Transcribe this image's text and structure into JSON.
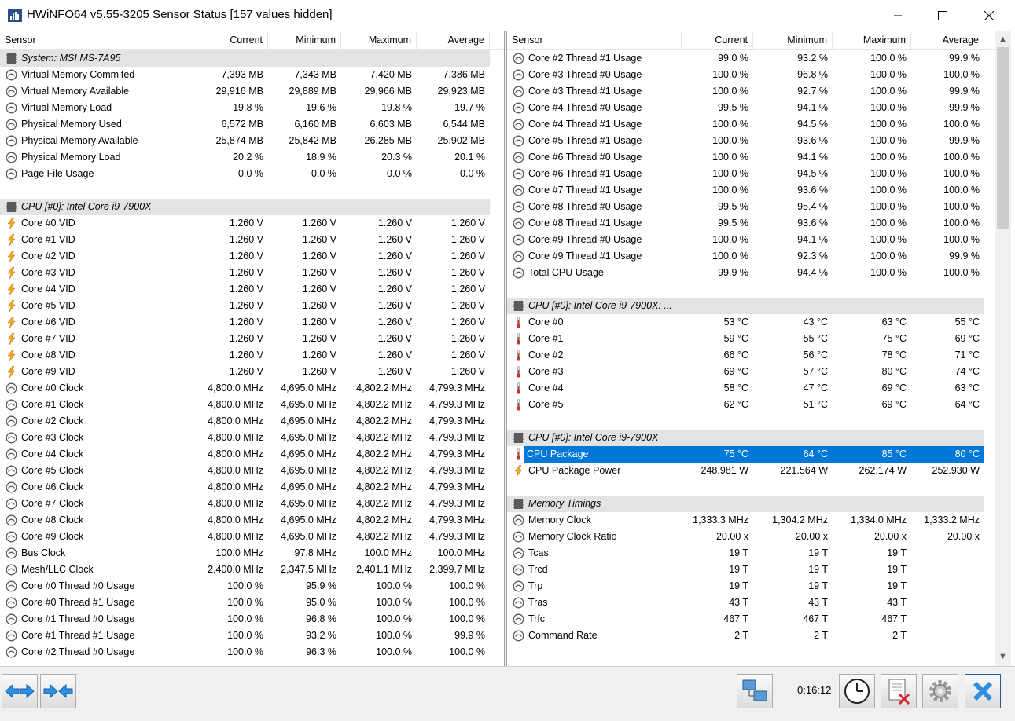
{
  "window": {
    "title": "HWiNFO64 v5.55-3205 Sensor Status [157 values hidden]"
  },
  "columns": {
    "sensor": "Sensor",
    "current": "Current",
    "minimum": "Minimum",
    "maximum": "Maximum",
    "average": "Average"
  },
  "left_rows": [
    {
      "t": "g",
      "icon": "chip",
      "name": "System: MSI MS-7A95"
    },
    {
      "t": "r",
      "icon": "gauge",
      "name": "Virtual Memory Commited",
      "v": [
        "7,393 MB",
        "7,343 MB",
        "7,420 MB",
        "7,386 MB"
      ]
    },
    {
      "t": "r",
      "icon": "gauge",
      "name": "Virtual Memory Available",
      "v": [
        "29,916 MB",
        "29,889 MB",
        "29,966 MB",
        "29,923 MB"
      ]
    },
    {
      "t": "r",
      "icon": "gauge",
      "name": "Virtual Memory Load",
      "v": [
        "19.8 %",
        "19.6 %",
        "19.8 %",
        "19.7 %"
      ]
    },
    {
      "t": "r",
      "icon": "gauge",
      "name": "Physical Memory Used",
      "v": [
        "6,572 MB",
        "6,160 MB",
        "6,603 MB",
        "6,544 MB"
      ]
    },
    {
      "t": "r",
      "icon": "gauge",
      "name": "Physical Memory Available",
      "v": [
        "25,874 MB",
        "25,842 MB",
        "26,285 MB",
        "25,902 MB"
      ]
    },
    {
      "t": "r",
      "icon": "gauge",
      "name": "Physical Memory Load",
      "v": [
        "20.2 %",
        "18.9 %",
        "20.3 %",
        "20.1 %"
      ]
    },
    {
      "t": "r",
      "icon": "gauge",
      "name": "Page File Usage",
      "v": [
        "0.0 %",
        "0.0 %",
        "0.0 %",
        "0.0 %"
      ]
    },
    {
      "t": "e"
    },
    {
      "t": "g",
      "icon": "chip",
      "name": "CPU [#0]: Intel Core i9-7900X"
    },
    {
      "t": "r",
      "icon": "bolt",
      "name": "Core #0 VID",
      "v": [
        "1.260 V",
        "1.260 V",
        "1.260 V",
        "1.260 V"
      ]
    },
    {
      "t": "r",
      "icon": "bolt",
      "name": "Core #1 VID",
      "v": [
        "1.260 V",
        "1.260 V",
        "1.260 V",
        "1.260 V"
      ]
    },
    {
      "t": "r",
      "icon": "bolt",
      "name": "Core #2 VID",
      "v": [
        "1.260 V",
        "1.260 V",
        "1.260 V",
        "1.260 V"
      ]
    },
    {
      "t": "r",
      "icon": "bolt",
      "name": "Core #3 VID",
      "v": [
        "1.260 V",
        "1.260 V",
        "1.260 V",
        "1.260 V"
      ]
    },
    {
      "t": "r",
      "icon": "bolt",
      "name": "Core #4 VID",
      "v": [
        "1.260 V",
        "1.260 V",
        "1.260 V",
        "1.260 V"
      ]
    },
    {
      "t": "r",
      "icon": "bolt",
      "name": "Core #5 VID",
      "v": [
        "1.260 V",
        "1.260 V",
        "1.260 V",
        "1.260 V"
      ]
    },
    {
      "t": "r",
      "icon": "bolt",
      "name": "Core #6 VID",
      "v": [
        "1.260 V",
        "1.260 V",
        "1.260 V",
        "1.260 V"
      ]
    },
    {
      "t": "r",
      "icon": "bolt",
      "name": "Core #7 VID",
      "v": [
        "1.260 V",
        "1.260 V",
        "1.260 V",
        "1.260 V"
      ]
    },
    {
      "t": "r",
      "icon": "bolt",
      "name": "Core #8 VID",
      "v": [
        "1.260 V",
        "1.260 V",
        "1.260 V",
        "1.260 V"
      ]
    },
    {
      "t": "r",
      "icon": "bolt",
      "name": "Core #9 VID",
      "v": [
        "1.260 V",
        "1.260 V",
        "1.260 V",
        "1.260 V"
      ]
    },
    {
      "t": "r",
      "icon": "gauge",
      "name": "Core #0 Clock",
      "v": [
        "4,800.0 MHz",
        "4,695.0 MHz",
        "4,802.2 MHz",
        "4,799.3 MHz"
      ]
    },
    {
      "t": "r",
      "icon": "gauge",
      "name": "Core #1 Clock",
      "v": [
        "4,800.0 MHz",
        "4,695.0 MHz",
        "4,802.2 MHz",
        "4,799.3 MHz"
      ]
    },
    {
      "t": "r",
      "icon": "gauge",
      "name": "Core #2 Clock",
      "v": [
        "4,800.0 MHz",
        "4,695.0 MHz",
        "4,802.2 MHz",
        "4,799.3 MHz"
      ]
    },
    {
      "t": "r",
      "icon": "gauge",
      "name": "Core #3 Clock",
      "v": [
        "4,800.0 MHz",
        "4,695.0 MHz",
        "4,802.2 MHz",
        "4,799.3 MHz"
      ]
    },
    {
      "t": "r",
      "icon": "gauge",
      "name": "Core #4 Clock",
      "v": [
        "4,800.0 MHz",
        "4,695.0 MHz",
        "4,802.2 MHz",
        "4,799.3 MHz"
      ]
    },
    {
      "t": "r",
      "icon": "gauge",
      "name": "Core #5 Clock",
      "v": [
        "4,800.0 MHz",
        "4,695.0 MHz",
        "4,802.2 MHz",
        "4,799.3 MHz"
      ]
    },
    {
      "t": "r",
      "icon": "gauge",
      "name": "Core #6 Clock",
      "v": [
        "4,800.0 MHz",
        "4,695.0 MHz",
        "4,802.2 MHz",
        "4,799.3 MHz"
      ]
    },
    {
      "t": "r",
      "icon": "gauge",
      "name": "Core #7 Clock",
      "v": [
        "4,800.0 MHz",
        "4,695.0 MHz",
        "4,802.2 MHz",
        "4,799.3 MHz"
      ]
    },
    {
      "t": "r",
      "icon": "gauge",
      "name": "Core #8 Clock",
      "v": [
        "4,800.0 MHz",
        "4,695.0 MHz",
        "4,802.2 MHz",
        "4,799.3 MHz"
      ]
    },
    {
      "t": "r",
      "icon": "gauge",
      "name": "Core #9 Clock",
      "v": [
        "4,800.0 MHz",
        "4,695.0 MHz",
        "4,802.2 MHz",
        "4,799.3 MHz"
      ]
    },
    {
      "t": "r",
      "icon": "gauge",
      "name": "Bus Clock",
      "v": [
        "100.0 MHz",
        "97.8 MHz",
        "100.0 MHz",
        "100.0 MHz"
      ]
    },
    {
      "t": "r",
      "icon": "gauge",
      "name": "Mesh/LLC Clock",
      "v": [
        "2,400.0 MHz",
        "2,347.5 MHz",
        "2,401.1 MHz",
        "2,399.7 MHz"
      ]
    },
    {
      "t": "r",
      "icon": "gauge",
      "name": "Core #0 Thread #0 Usage",
      "v": [
        "100.0 %",
        "95.9 %",
        "100.0 %",
        "100.0 %"
      ]
    },
    {
      "t": "r",
      "icon": "gauge",
      "name": "Core #0 Thread #1 Usage",
      "v": [
        "100.0 %",
        "95.0 %",
        "100.0 %",
        "100.0 %"
      ]
    },
    {
      "t": "r",
      "icon": "gauge",
      "name": "Core #1 Thread #0 Usage",
      "v": [
        "100.0 %",
        "96.8 %",
        "100.0 %",
        "100.0 %"
      ]
    },
    {
      "t": "r",
      "icon": "gauge",
      "name": "Core #1 Thread #1 Usage",
      "v": [
        "100.0 %",
        "93.2 %",
        "100.0 %",
        "99.9 %"
      ]
    },
    {
      "t": "r",
      "icon": "gauge",
      "name": "Core #2 Thread #0 Usage",
      "v": [
        "100.0 %",
        "96.3 %",
        "100.0 %",
        "100.0 %"
      ]
    }
  ],
  "right_rows": [
    {
      "t": "r",
      "icon": "gauge",
      "name": "Core #2 Thread #1 Usage",
      "v": [
        "99.0 %",
        "93.2 %",
        "100.0 %",
        "99.9 %"
      ]
    },
    {
      "t": "r",
      "icon": "gauge",
      "name": "Core #3 Thread #0 Usage",
      "v": [
        "100.0 %",
        "96.8 %",
        "100.0 %",
        "100.0 %"
      ]
    },
    {
      "t": "r",
      "icon": "gauge",
      "name": "Core #3 Thread #1 Usage",
      "v": [
        "100.0 %",
        "92.7 %",
        "100.0 %",
        "99.9 %"
      ]
    },
    {
      "t": "r",
      "icon": "gauge",
      "name": "Core #4 Thread #0 Usage",
      "v": [
        "99.5 %",
        "94.1 %",
        "100.0 %",
        "99.9 %"
      ]
    },
    {
      "t": "r",
      "icon": "gauge",
      "name": "Core #4 Thread #1 Usage",
      "v": [
        "100.0 %",
        "94.5 %",
        "100.0 %",
        "100.0 %"
      ]
    },
    {
      "t": "r",
      "icon": "gauge",
      "name": "Core #5 Thread #1 Usage",
      "v": [
        "100.0 %",
        "93.6 %",
        "100.0 %",
        "99.9 %"
      ]
    },
    {
      "t": "r",
      "icon": "gauge",
      "name": "Core #6 Thread #0 Usage",
      "v": [
        "100.0 %",
        "94.1 %",
        "100.0 %",
        "100.0 %"
      ]
    },
    {
      "t": "r",
      "icon": "gauge",
      "name": "Core #6 Thread #1 Usage",
      "v": [
        "100.0 %",
        "94.5 %",
        "100.0 %",
        "100.0 %"
      ]
    },
    {
      "t": "r",
      "icon": "gauge",
      "name": "Core #7 Thread #1 Usage",
      "v": [
        "100.0 %",
        "93.6 %",
        "100.0 %",
        "100.0 %"
      ]
    },
    {
      "t": "r",
      "icon": "gauge",
      "name": "Core #8 Thread #0 Usage",
      "v": [
        "99.5 %",
        "95.4 %",
        "100.0 %",
        "100.0 %"
      ]
    },
    {
      "t": "r",
      "icon": "gauge",
      "name": "Core #8 Thread #1 Usage",
      "v": [
        "99.5 %",
        "93.6 %",
        "100.0 %",
        "100.0 %"
      ]
    },
    {
      "t": "r",
      "icon": "gauge",
      "name": "Core #9 Thread #0 Usage",
      "v": [
        "100.0 %",
        "94.1 %",
        "100.0 %",
        "100.0 %"
      ]
    },
    {
      "t": "r",
      "icon": "gauge",
      "name": "Core #9 Thread #1 Usage",
      "v": [
        "100.0 %",
        "92.3 %",
        "100.0 %",
        "99.9 %"
      ]
    },
    {
      "t": "r",
      "icon": "gauge",
      "name": "Total CPU Usage",
      "v": [
        "99.9 %",
        "94.4 %",
        "100.0 %",
        "100.0 %"
      ]
    },
    {
      "t": "e"
    },
    {
      "t": "g",
      "icon": "chip",
      "name": "CPU [#0]: Intel Core i9-7900X: ..."
    },
    {
      "t": "r",
      "icon": "therm",
      "name": "Core #0",
      "v": [
        "53 °C",
        "43 °C",
        "63 °C",
        "55 °C"
      ]
    },
    {
      "t": "r",
      "icon": "therm",
      "name": "Core #1",
      "v": [
        "59 °C",
        "55 °C",
        "75 °C",
        "69 °C"
      ]
    },
    {
      "t": "r",
      "icon": "therm",
      "name": "Core #2",
      "v": [
        "66 °C",
        "56 °C",
        "78 °C",
        "71 °C"
      ]
    },
    {
      "t": "r",
      "icon": "therm",
      "name": "Core #3",
      "v": [
        "69 °C",
        "57 °C",
        "80 °C",
        "74 °C"
      ]
    },
    {
      "t": "r",
      "icon": "therm",
      "name": "Core #4",
      "v": [
        "58 °C",
        "47 °C",
        "69 °C",
        "63 °C"
      ]
    },
    {
      "t": "r",
      "icon": "therm",
      "name": "Core #5",
      "v": [
        "62 °C",
        "51 °C",
        "69 °C",
        "64 °C"
      ]
    },
    {
      "t": "e"
    },
    {
      "t": "g",
      "icon": "chip",
      "name": "CPU [#0]: Intel Core i9-7900X"
    },
    {
      "t": "r",
      "icon": "therm",
      "name": "CPU Package",
      "v": [
        "75 °C",
        "64 °C",
        "85 °C",
        "80 °C"
      ],
      "selected": true
    },
    {
      "t": "r",
      "icon": "bolt",
      "name": "CPU Package Power",
      "v": [
        "248.981 W",
        "221.564 W",
        "262.174 W",
        "252.930 W"
      ]
    },
    {
      "t": "e"
    },
    {
      "t": "g",
      "icon": "chip",
      "name": "Memory Timings"
    },
    {
      "t": "r",
      "icon": "gauge",
      "name": "Memory Clock",
      "v": [
        "1,333.3 MHz",
        "1,304.2 MHz",
        "1,334.0 MHz",
        "1,333.2 MHz"
      ]
    },
    {
      "t": "r",
      "icon": "gauge",
      "name": "Memory Clock Ratio",
      "v": [
        "20.00 x",
        "20.00 x",
        "20.00 x",
        "20.00 x"
      ]
    },
    {
      "t": "r",
      "icon": "gauge",
      "name": "Tcas",
      "v": [
        "19 T",
        "19 T",
        "19 T",
        ""
      ]
    },
    {
      "t": "r",
      "icon": "gauge",
      "name": "Trcd",
      "v": [
        "19 T",
        "19 T",
        "19 T",
        ""
      ]
    },
    {
      "t": "r",
      "icon": "gauge",
      "name": "Trp",
      "v": [
        "19 T",
        "19 T",
        "19 T",
        ""
      ]
    },
    {
      "t": "r",
      "icon": "gauge",
      "name": "Tras",
      "v": [
        "43 T",
        "43 T",
        "43 T",
        ""
      ]
    },
    {
      "t": "r",
      "icon": "gauge",
      "name": "Trfc",
      "v": [
        "467 T",
        "467 T",
        "467 T",
        ""
      ]
    },
    {
      "t": "r",
      "icon": "gauge",
      "name": "Command Rate",
      "v": [
        "2 T",
        "2 T",
        "2 T",
        ""
      ]
    }
  ],
  "footer": {
    "elapsed_time": "0:16:12"
  },
  "colors": {
    "selection": "#0078d7",
    "group_bg": "#e3e3e3",
    "bolt": "#f5a623",
    "therm": "#c0392b"
  }
}
